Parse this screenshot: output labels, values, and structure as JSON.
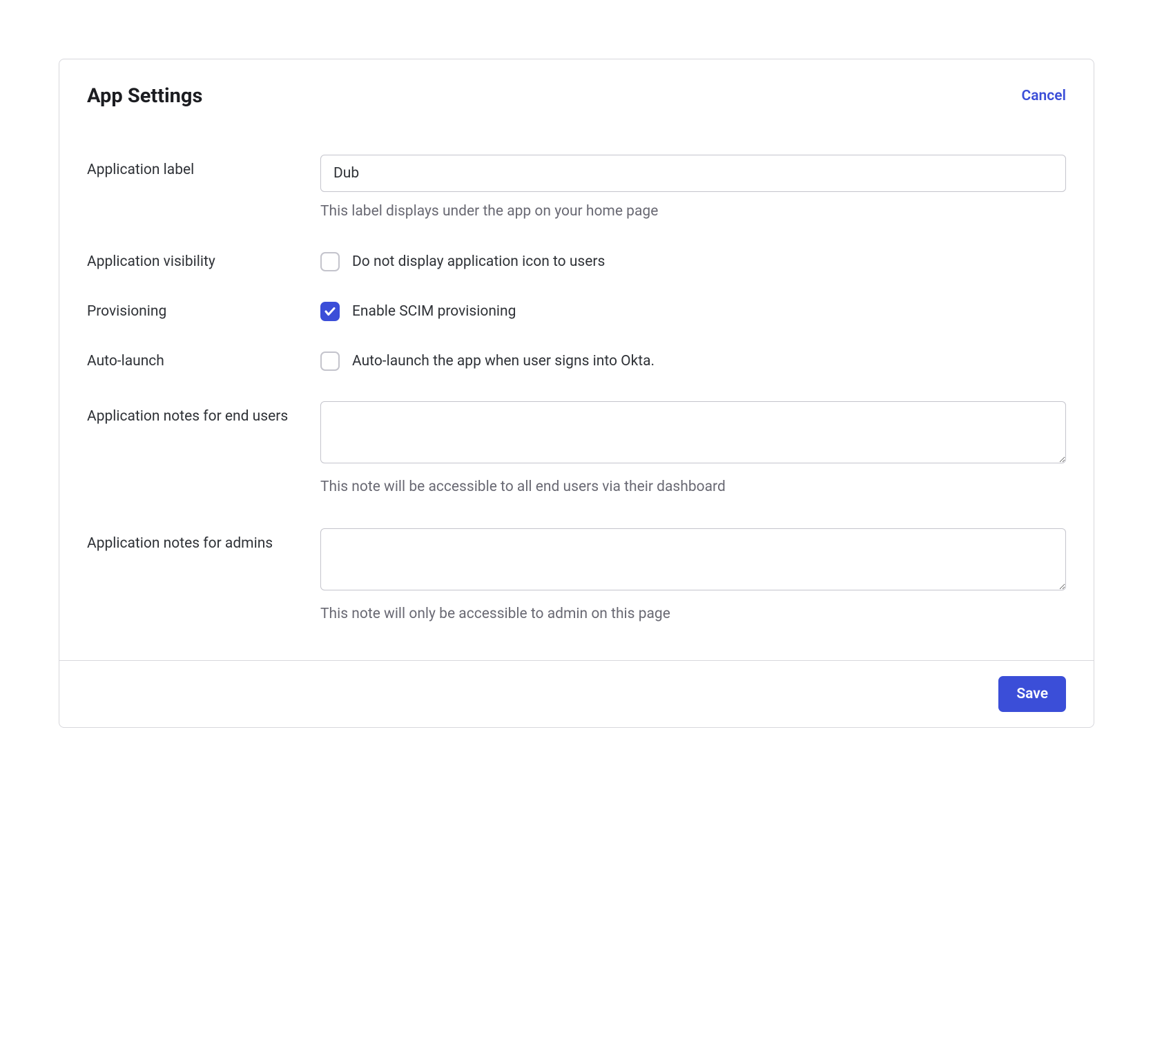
{
  "header": {
    "title": "App Settings",
    "cancel": "Cancel"
  },
  "form": {
    "application_label": {
      "label": "Application label",
      "value": "Dub",
      "helper": "This label displays under the app on your home page"
    },
    "application_visibility": {
      "label": "Application visibility",
      "option": "Do not display application icon to users",
      "checked": false
    },
    "provisioning": {
      "label": "Provisioning",
      "option": "Enable SCIM provisioning",
      "checked": true
    },
    "auto_launch": {
      "label": "Auto-launch",
      "option": "Auto-launch the app when user signs into Okta.",
      "checked": false
    },
    "notes_end_users": {
      "label": "Application notes for end users",
      "value": "",
      "helper": "This note will be accessible to all end users via their dashboard"
    },
    "notes_admins": {
      "label": "Application notes for admins",
      "value": "",
      "helper": "This note will only be accessible to admin on this page"
    }
  },
  "footer": {
    "save": "Save"
  }
}
